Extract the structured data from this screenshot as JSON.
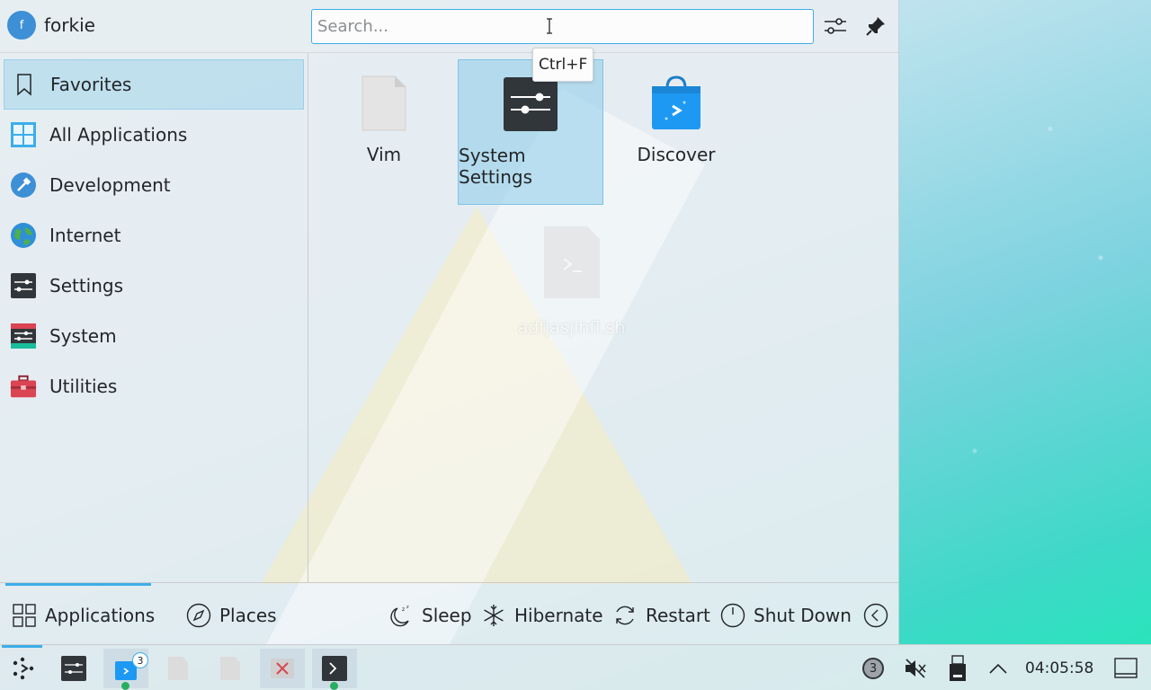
{
  "header": {
    "avatar_letter": "f",
    "username": "forkie",
    "search_placeholder": "Search...",
    "tooltip": "Ctrl+F"
  },
  "sidebar": {
    "items": [
      {
        "label": "Favorites",
        "icon": "bookmark-icon"
      },
      {
        "label": "All Applications",
        "icon": "grid-apps-icon"
      },
      {
        "label": "Development",
        "icon": "hammer-icon"
      },
      {
        "label": "Internet",
        "icon": "globe-icon"
      },
      {
        "label": "Settings",
        "icon": "settings-sliders-icon"
      },
      {
        "label": "System",
        "icon": "system-icon"
      },
      {
        "label": "Utilities",
        "icon": "toolbox-icon"
      }
    ]
  },
  "grid": {
    "apps": [
      {
        "label": "Vim",
        "icon": "file-icon"
      },
      {
        "label": "System Settings",
        "icon": "system-settings-icon"
      },
      {
        "label": "Discover",
        "icon": "shopping-bag-icon"
      }
    ],
    "drag_ghost": "adfjasjlhfl.sh"
  },
  "footer": {
    "tabs": [
      {
        "label": "Applications",
        "icon": "apps-grid-icon"
      },
      {
        "label": "Places",
        "icon": "compass-icon"
      }
    ],
    "actions": [
      {
        "label": "Sleep",
        "icon": "sleep-moon-icon"
      },
      {
        "label": "Hibernate",
        "icon": "snowflake-icon"
      },
      {
        "label": "Restart",
        "icon": "restart-icon"
      },
      {
        "label": "Shut Down",
        "icon": "power-icon"
      }
    ]
  },
  "taskbar": {
    "discover_badge": "3",
    "notifications_count": "3",
    "clock": "04:05:58"
  },
  "colors": {
    "accent": "#3daee9",
    "selection": "#93cee9"
  }
}
